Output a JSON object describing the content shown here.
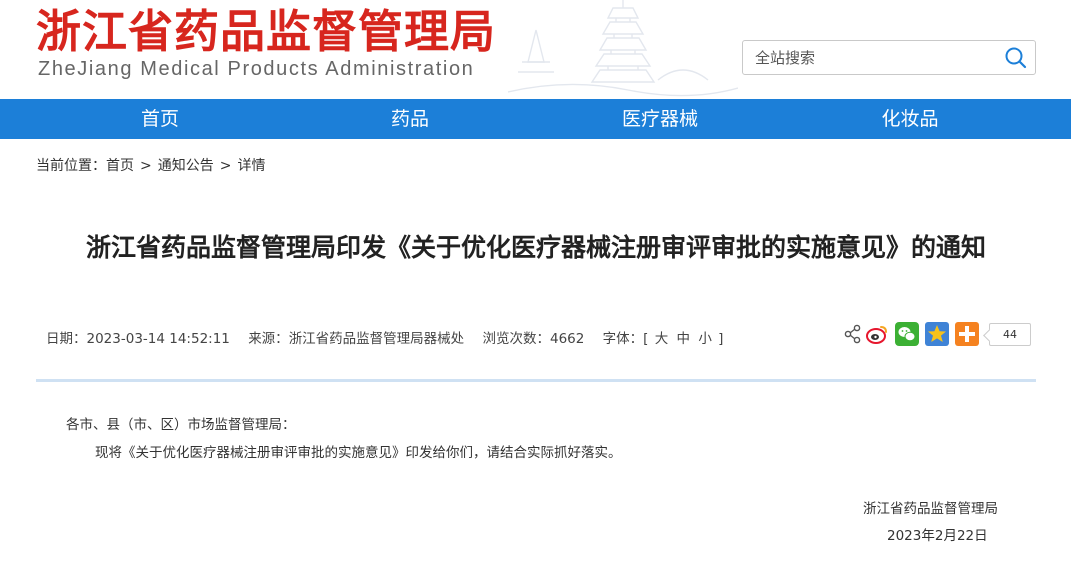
{
  "header": {
    "logo_cn": "浙江省药品监督管理局",
    "logo_en": "ZheJiang Medical Products Administration"
  },
  "search": {
    "placeholder": "全站搜索",
    "button_icon": "search-icon"
  },
  "nav": {
    "items": [
      "首页",
      "药品",
      "医疗器械",
      "化妆品"
    ]
  },
  "breadcrumb": {
    "prefix": "当前位置：",
    "items": [
      "首页",
      "通知公告",
      "详情"
    ],
    "separator": ">"
  },
  "article": {
    "title": "浙江省药品监督管理局印发《关于优化医疗器械注册审评审批的实施意见》的通知",
    "meta": {
      "date_label": "日期：",
      "date": "2023-03-14 14:52:11",
      "source_label": "来源：",
      "source": "浙江省药品监督管理局器械处",
      "views_label": "浏览次数：",
      "views": "4662",
      "font_label": "字体：",
      "font_open": "[",
      "font_large": "大",
      "font_medium": "中",
      "font_small": "小",
      "font_close": "]"
    },
    "share": {
      "icons": [
        "share-icon",
        "weibo-icon",
        "wechat-icon",
        "qzone-icon",
        "more-share-icon"
      ],
      "count": "44"
    },
    "greeting": "各市、县（市、区）市场监督管理局：",
    "body": "现将《关于优化医疗器械注册审评审批的实施意见》印发给你们，请结合实际抓好落实。",
    "signature_org": "浙江省药品监督管理局",
    "signature_date": "2023年2月22日"
  },
  "colors": {
    "logo_red": "#d7261e",
    "nav_blue": "#1c7fd8",
    "divider": "#cfe1f3"
  }
}
